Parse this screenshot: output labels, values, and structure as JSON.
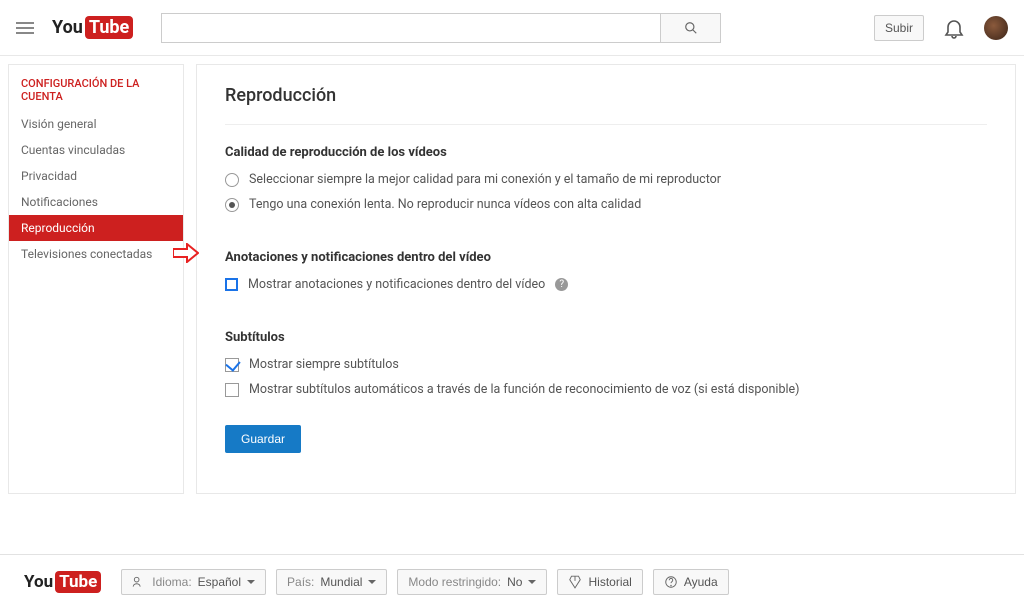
{
  "header": {
    "logo_text_1": "You",
    "logo_text_2": "Tube",
    "search_placeholder": "",
    "upload_label": "Subir"
  },
  "sidebar": {
    "title": "CONFIGURACIÓN DE LA CUENTA",
    "items": [
      {
        "label": "Visión general",
        "active": false
      },
      {
        "label": "Cuentas vinculadas",
        "active": false
      },
      {
        "label": "Privacidad",
        "active": false
      },
      {
        "label": "Notificaciones",
        "active": false
      },
      {
        "label": "Reproducción",
        "active": true
      },
      {
        "label": "Televisiones conectadas",
        "active": false
      }
    ]
  },
  "main": {
    "page_title": "Reproducción",
    "quality_section_title": "Calidad de reproducción de los vídeos",
    "quality_option_1": "Seleccionar siempre la mejor calidad para mi conexión y el tamaño de mi reproductor",
    "quality_option_2": "Tengo una conexión lenta. No reproducir nunca vídeos con alta calidad",
    "annotations_section_title": "Anotaciones y notificaciones dentro del vídeo",
    "annotations_checkbox_label": "Mostrar anotaciones y notificaciones dentro del vídeo",
    "subtitles_section_title": "Subtítulos",
    "subtitles_option_1": "Mostrar siempre subtítulos",
    "subtitles_option_2": "Mostrar subtítulos automáticos a través de la función de reconocimiento de voz (si está disponible)",
    "save_button": "Guardar"
  },
  "footer": {
    "language_key": "Idioma:",
    "language_val": "Español",
    "country_key": "País:",
    "country_val": "Mundial",
    "restricted_key": "Modo restringido:",
    "restricted_val": "No",
    "history": "Historial",
    "help": "Ayuda"
  }
}
